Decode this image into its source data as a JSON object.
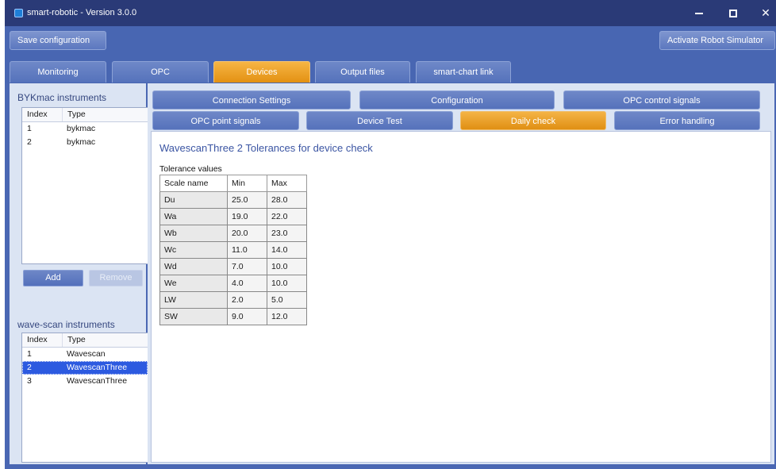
{
  "window": {
    "title": "smart-robotic - Version 3.0.0",
    "controls": {
      "minimize_icon": "minimize-icon",
      "maximize_icon": "maximize-icon",
      "close_icon": "close-icon",
      "close_glyph": "✕"
    }
  },
  "toolbar": {
    "save_label": "Save configuration",
    "simulator_label": "Activate Robot Simulator"
  },
  "main_tabs": [
    "Monitoring",
    "OPC",
    "Devices",
    "Output files",
    "smart-chart link"
  ],
  "main_tab_active": "Devices",
  "byk": {
    "title": "BYKmac instruments",
    "headers": {
      "index": "Index",
      "type": "Type"
    },
    "rows": [
      {
        "index": "1",
        "type": "bykmac"
      },
      {
        "index": "2",
        "type": "bykmac"
      }
    ],
    "add_label": "Add",
    "remove_label": "Remove"
  },
  "wavescan": {
    "title": "wave-scan instruments",
    "headers": {
      "index": "Index",
      "type": "Type"
    },
    "rows": [
      {
        "index": "1",
        "type": "Wavescan"
      },
      {
        "index": "2",
        "type": "WavescanThree"
      },
      {
        "index": "3",
        "type": "WavescanThree"
      }
    ],
    "selected_index": "2"
  },
  "sub_tabs_row1": [
    "Connection Settings",
    "Configuration",
    "OPC control signals"
  ],
  "sub_tabs_row2": [
    "OPC point signals",
    "Device Test",
    "Daily check",
    "Error handling"
  ],
  "sub_tab_active": "Daily check",
  "daily_check": {
    "title": "WavescanThree 2 Tolerances for device check",
    "caption": "Tolerance values",
    "headers": {
      "scale": "Scale name",
      "min": "Min",
      "max": "Max"
    },
    "rows": [
      {
        "scale": "Du",
        "min": "25.0",
        "max": "28.0"
      },
      {
        "scale": "Wa",
        "min": "19.0",
        "max": "22.0"
      },
      {
        "scale": "Wb",
        "min": "20.0",
        "max": "23.0"
      },
      {
        "scale": "Wc",
        "min": "11.0",
        "max": "14.0"
      },
      {
        "scale": "Wd",
        "min": "7.0",
        "max": "10.0"
      },
      {
        "scale": "We",
        "min": "4.0",
        "max": "10.0"
      },
      {
        "scale": "LW",
        "min": "2.0",
        "max": "5.0"
      },
      {
        "scale": "SW",
        "min": "9.0",
        "max": "12.0"
      }
    ]
  },
  "colors": {
    "title_bar": "#2a3a77",
    "chrome": "#4866b2",
    "active_tab": "#e8981f",
    "selection": "#2c5ae0",
    "heading_text": "#3b55a3"
  }
}
